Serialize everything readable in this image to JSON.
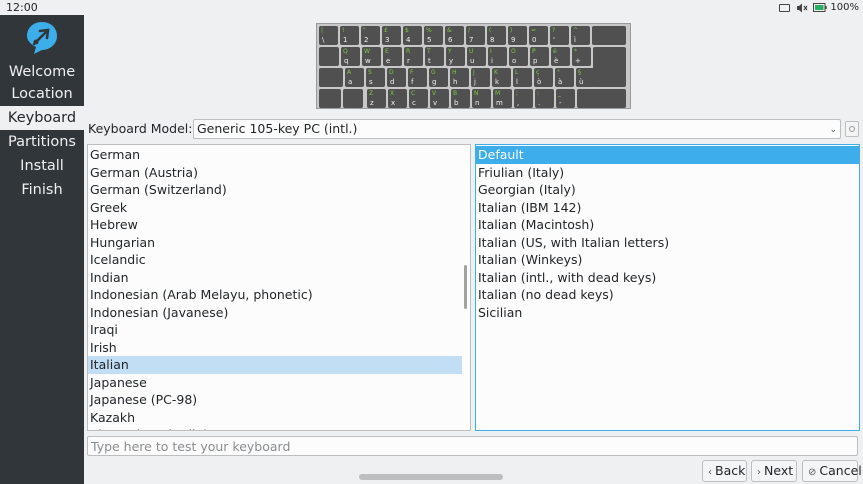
{
  "status_bar": {
    "clock": "12:00",
    "battery_percent": "100%",
    "icons": [
      "display-icon",
      "speaker-muted-icon",
      "battery-icon"
    ]
  },
  "sidebar": {
    "logo_icon": "calamares-logo-icon",
    "steps": [
      {
        "label": "Welcome",
        "current": false
      },
      {
        "label": "Location",
        "current": false
      },
      {
        "label": "Keyboard",
        "current": true
      },
      {
        "label": "Partitions",
        "current": false
      },
      {
        "label": "Install",
        "current": false
      },
      {
        "label": "Finish",
        "current": false
      }
    ]
  },
  "keyboard_preview": {
    "rows": [
      [
        "\\",
        "1",
        "2",
        "3",
        "4",
        "5",
        "6",
        "7",
        "8",
        "9",
        "0",
        "'",
        "ì"
      ],
      [
        "q",
        "w",
        "e",
        "r",
        "t",
        "y",
        "u",
        "i",
        "o",
        "p",
        "è",
        "+"
      ],
      [
        "a",
        "s",
        "d",
        "f",
        "g",
        "h",
        "j",
        "k",
        "l",
        "ò",
        "à",
        "ù"
      ],
      [
        "z",
        "x",
        "c",
        "v",
        "b",
        "n",
        "m",
        ",",
        ".",
        "-"
      ]
    ],
    "shift_rows": [
      [
        "|",
        "!",
        "\"",
        "£",
        "$",
        "%",
        "&",
        "/",
        "(",
        ")",
        "=",
        "?",
        "^"
      ],
      [
        "Q",
        "W",
        "E",
        "R",
        "T",
        "Y",
        "U",
        "I",
        "O",
        "P",
        "é",
        "*"
      ],
      [
        "A",
        "S",
        "D",
        "F",
        "G",
        "H",
        "J",
        "K",
        "L",
        "ç",
        "°",
        "§"
      ],
      [
        "Z",
        "X",
        "C",
        "V",
        "B",
        "N",
        "M",
        ";",
        ":",
        "_"
      ]
    ]
  },
  "model": {
    "label": "Keyboard Model:",
    "value": "Generic 105-key PC (intl.)"
  },
  "layouts": {
    "items": [
      "German",
      "German (Austria)",
      "German (Switzerland)",
      "Greek",
      "Hebrew",
      "Hungarian",
      "Icelandic",
      "Indian",
      "Indonesian (Arab Melayu, phonetic)",
      "Indonesian (Javanese)",
      "Iraqi",
      "Irish",
      "Italian",
      "Japanese",
      "Japanese (PC-98)",
      "Kazakh",
      "Khmer (Cambodia)"
    ],
    "selected": "Italian"
  },
  "variants": {
    "items": [
      "Default",
      "Friulian (Italy)",
      "Georgian (Italy)",
      "Italian (IBM 142)",
      "Italian (Macintosh)",
      "Italian (US, with Italian letters)",
      "Italian (Winkeys)",
      "Italian (intl., with dead keys)",
      "Italian (no dead keys)",
      "Sicilian"
    ],
    "selected": "Default"
  },
  "test_input": {
    "value": "",
    "placeholder": "Type here to test your keyboard"
  },
  "buttons": {
    "back": "Back",
    "next": "Next",
    "cancel": "Cancel"
  },
  "colors": {
    "sidebar": "#31363b",
    "accent": "#3daee9",
    "selection_light": "#c2def5",
    "key_legend": "#79c940"
  }
}
